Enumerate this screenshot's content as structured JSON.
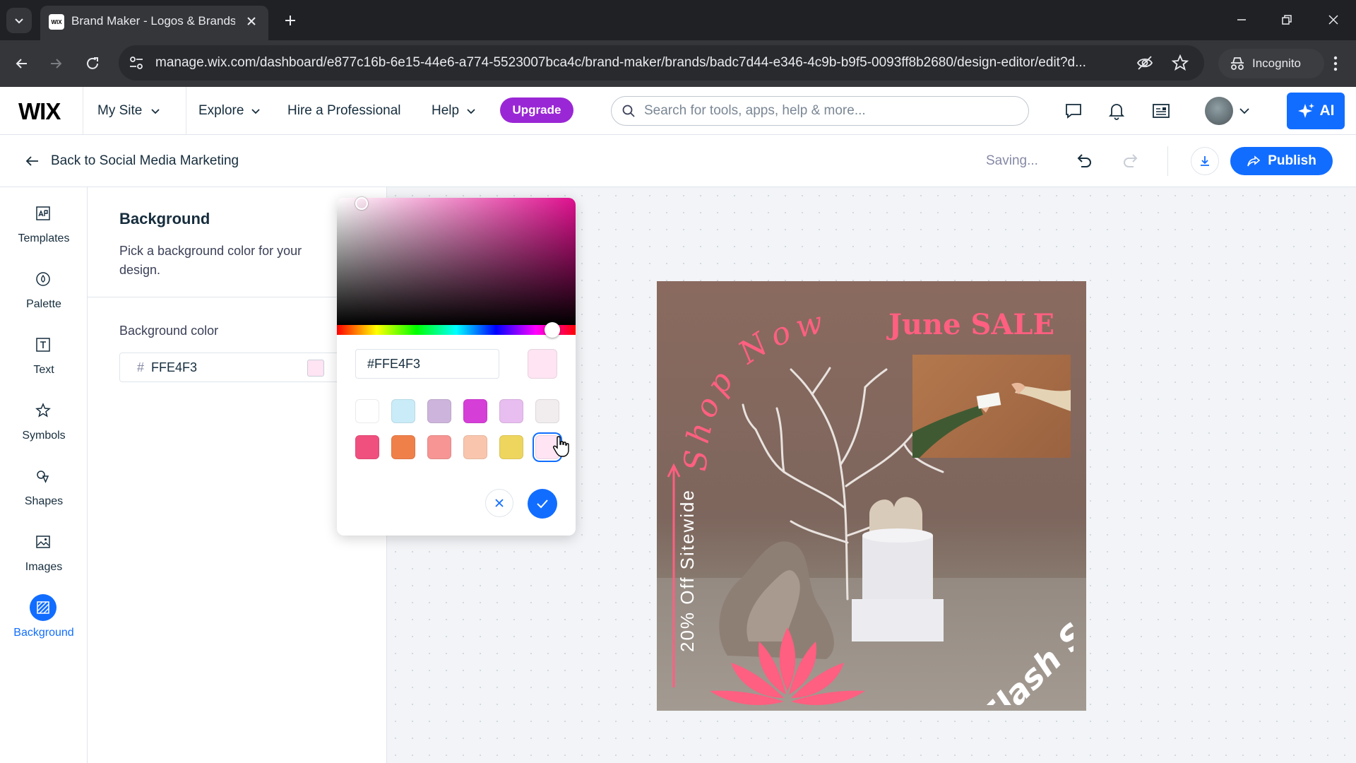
{
  "browser": {
    "tab_title": "Brand Maker - Logos & Brands",
    "url": "manage.wix.com/dashboard/e877c16b-6e15-44e6-a774-5523007bca4c/brand-maker/brands/badc7d44-e346-4c9b-b9f5-0093ff8b2680/design-editor/edit?d...",
    "incognito_label": "Incognito",
    "favicon_text": "WIX"
  },
  "wix_header": {
    "logo": "WIX",
    "site_menu": "My Site",
    "nav": [
      {
        "label": "Explore",
        "has_chevron": true
      },
      {
        "label": "Hire a Professional",
        "has_chevron": false
      },
      {
        "label": "Help",
        "has_chevron": true
      }
    ],
    "upgrade_label": "Upgrade",
    "search_placeholder": "Search for tools, apps, help & more...",
    "ai_label": "AI"
  },
  "subheader": {
    "back_label": "Back to Social Media Marketing",
    "status": "Saving...",
    "publish_label": "Publish"
  },
  "rail": {
    "items": [
      {
        "label": "Templates",
        "icon": "templates-icon",
        "active": false
      },
      {
        "label": "Palette",
        "icon": "palette-icon",
        "active": false
      },
      {
        "label": "Text",
        "icon": "text-icon",
        "active": false
      },
      {
        "label": "Symbols",
        "icon": "star-icon",
        "active": false
      },
      {
        "label": "Shapes",
        "icon": "shapes-icon",
        "active": false
      },
      {
        "label": "Images",
        "icon": "image-icon",
        "active": false
      },
      {
        "label": "Background",
        "icon": "background-icon",
        "active": true
      }
    ]
  },
  "panel": {
    "title": "Background",
    "description": "Pick a background color for your design.",
    "color_label": "Background color",
    "hash": "#",
    "hex_value": "FFE4F3",
    "current_color": "#FFE4F3"
  },
  "picker": {
    "hex_value": "#FFE4F3",
    "hue_color": "#E0108F",
    "swatches": [
      "#FFFFFF",
      "#C9ECF8",
      "#CDB4DC",
      "#D63ED8",
      "#E8BDEF",
      "#F1ECEE",
      "#F0507E",
      "#F0804A",
      "#F69593",
      "#F9C6AD",
      "#EED55E",
      "#FFE4F3"
    ],
    "selected_swatch": 11
  },
  "design": {
    "shop_now": "Shop Now",
    "june_sale": "June SALE",
    "offer": "20% Off Sitewide",
    "flash_sale": "Flash Sale",
    "accent": "#FF5F80"
  }
}
